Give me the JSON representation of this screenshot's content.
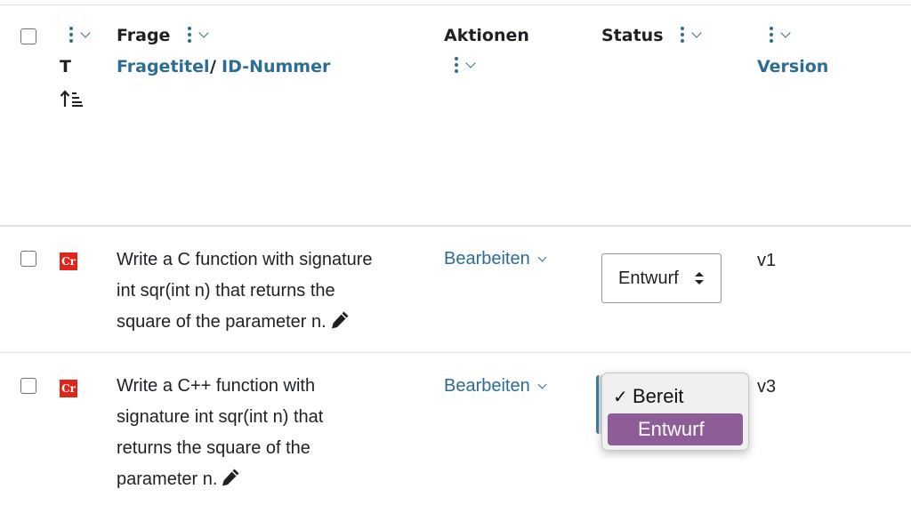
{
  "header": {
    "type_col": {
      "label": "T"
    },
    "question_col": {
      "label": "Frage",
      "sort_title": "Fragetitel",
      "separator": "/",
      "sort_id": "ID-Nummer"
    },
    "actions_col": {
      "label": "Aktionen"
    },
    "status_col": {
      "label": "Status"
    },
    "version_col": {
      "label": "Version"
    }
  },
  "rows": [
    {
      "type_icon": "Cr",
      "text_lines": [
        "Write a C function with signature",
        "int sqr(int n) that returns the",
        "square of the parameter n."
      ],
      "action": "Bearbeiten",
      "status": "Entwurf",
      "version": "v1"
    },
    {
      "type_icon": "Cr",
      "text_lines": [
        "Write a C++ function with",
        "signature int sqr(int n) that",
        "returns the square of the",
        "parameter n."
      ],
      "action": "Bearbeiten",
      "version": "v3",
      "status_options": [
        {
          "label": "Bereit",
          "checked": true
        },
        {
          "label": "Entwurf",
          "highlighted": true
        }
      ]
    }
  ],
  "icons": {
    "kebab": "kebab-menu-icon",
    "chevron": "chevron-down-icon",
    "sort": "sort-ascending-icon",
    "pencil": "pencil-icon",
    "updown": "select-arrows-icon",
    "check": "checkmark-icon"
  },
  "colors": {
    "link": "#2b6d95",
    "qtype_icon": "#e3241b",
    "option_highlight": "#8e5d97"
  }
}
